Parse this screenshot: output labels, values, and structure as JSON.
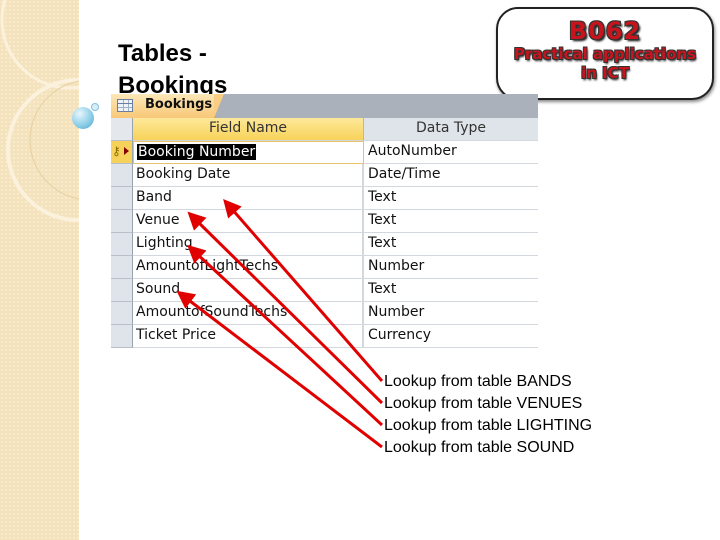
{
  "slide": {
    "title": "Tables - Bookings"
  },
  "badge": {
    "code": "B062",
    "line1": "Practical applications",
    "line2": "in ICT"
  },
  "table_design": {
    "tab_label": "Bookings",
    "headers": {
      "field_name": "Field Name",
      "data_type": "Data Type"
    },
    "rows": [
      {
        "field": "Booking Number",
        "type": "AutoNumber",
        "primary_key": true,
        "selected": true
      },
      {
        "field": "Booking Date",
        "type": "Date/Time"
      },
      {
        "field": "Band",
        "type": "Text"
      },
      {
        "field": "Venue",
        "type": "Text"
      },
      {
        "field": "Lighting",
        "type": "Text"
      },
      {
        "field": "AmountofLightTechs",
        "type": "Number"
      },
      {
        "field": "Sound",
        "type": "Text"
      },
      {
        "field": "AmountofSoundTechs",
        "type": "Number"
      },
      {
        "field": "Ticket Price",
        "type": "Currency"
      }
    ]
  },
  "annotations": [
    "Lookup from table BANDS",
    "Lookup from table VENUES",
    "Lookup from table LIGHTING",
    "Lookup from table SOUND"
  ],
  "colors": {
    "arrow": "#e00000",
    "badge_text": "#c8141c",
    "header_field": "#f8d35a"
  }
}
